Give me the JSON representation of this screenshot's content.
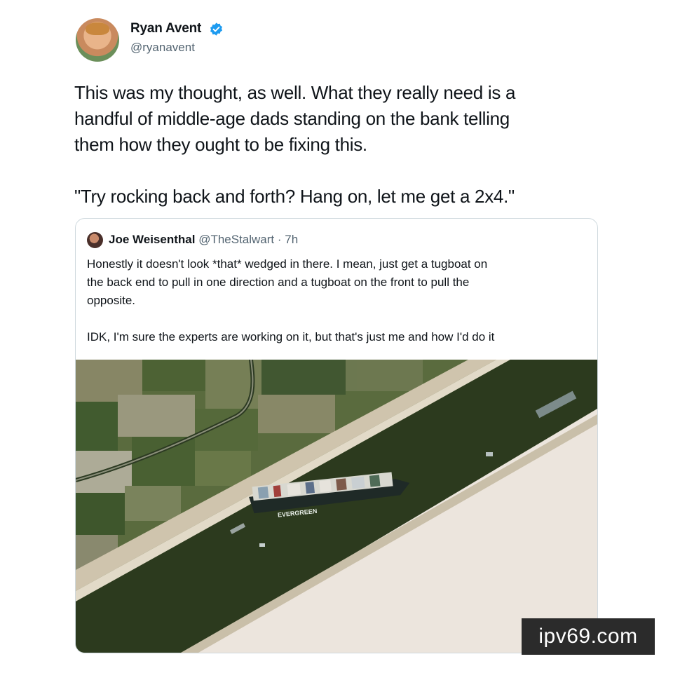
{
  "tweet": {
    "author": {
      "name": "Ryan Avent",
      "handle": "@ryanavent",
      "verified": true
    },
    "text": "This was my thought, as well. What they really need is a\nhandful of middle-age dads standing on the bank telling\nthem how they ought to be fixing this.\n\n\"Try rocking back and forth? Hang on, let me get a 2x4.\""
  },
  "quoted_tweet": {
    "author_name": "Joe Weisenthal",
    "handle_time": "@TheStalwart · 7h",
    "text": "Honestly it doesn't look *that* wedged in there. I mean, just get a tugboat on\nthe back end to pull in one direction and a tugboat on the front to pull the\nopposite.\n\nIDK, I'm sure the experts are working on it, but that's just me and how I'd do it",
    "image": {
      "ship_label": "EVERGREEN"
    }
  },
  "watermark": "ipv69.com",
  "colors": {
    "verified_blue": "#1d9bf0",
    "secondary_text": "#536471",
    "canal_water": "#2c3a1e",
    "desert_sand": "#ece5dd"
  }
}
